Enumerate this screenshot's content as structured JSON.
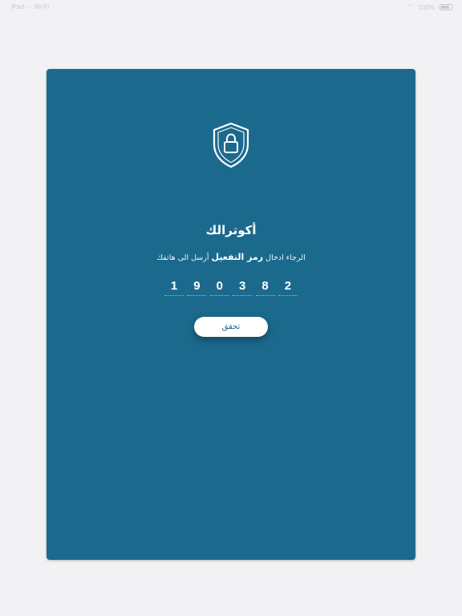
{
  "status_bar": {
    "left_text": "iPad  ⋯  Wi-Fi",
    "right_text": "100%"
  },
  "card": {
    "icon": "shield-lock-icon",
    "title": "أكوترالك",
    "subtitle": {
      "before": "الرجاء ادخال ",
      "emphasis": "رمز التفعيل",
      "after": " أرسل الى هاتفك"
    },
    "code_digits": [
      "1",
      "9",
      "0",
      "3",
      "8",
      "2"
    ],
    "verify_button_label": "تحقق"
  },
  "colors": {
    "background": "#f2f2f4",
    "card": "#1b6a8e",
    "button": "#ffffff",
    "button_text": "#1b6a8e"
  }
}
